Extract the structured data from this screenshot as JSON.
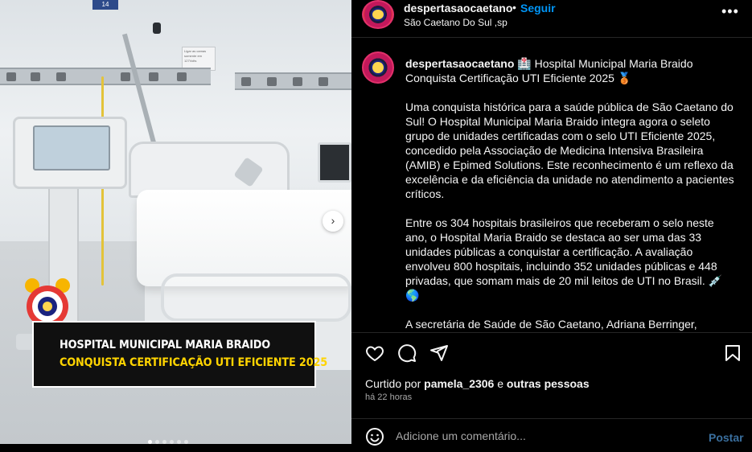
{
  "media": {
    "room_sign": "14",
    "wall_note": "Ligar as camas somente em 127Volts",
    "caption_line1": "HOSPITAL MUNICIPAL MARIA BRAIDO",
    "caption_line2": "CONQUISTA CERTIFICAÇÃO UTI EFICIENTE 2025",
    "next_icon": "›",
    "carousel_count": 6,
    "carousel_active": 0
  },
  "header": {
    "username": "despertasaocaetano",
    "separator": "•",
    "follow_label": "Seguir",
    "location": "São Caetano Do Sul ,sp",
    "more_icon": "•••"
  },
  "post": {
    "username": "despertasaocaetano",
    "title": "🏥 Hospital Municipal Maria Braido Conquista Certificação UTI Eficiente 2025 🥉",
    "paragraph1": "Uma conquista histórica para a saúde pública de São Caetano do Sul! O Hospital Municipal Maria Braido integra agora o seleto grupo de unidades certificadas com o selo UTI Eficiente 2025, concedido pela Associação de Medicina Intensiva Brasileira (AMIB) e Epimed Solutions. Este reconhecimento é um reflexo da excelência e da eficiência da unidade no atendimento a pacientes críticos.",
    "paragraph2": "Entre os 304 hospitais brasileiros que receberam o selo neste ano, o Hospital Maria Braido se destaca ao ser uma das 33 unidades públicas a conquistar a certificação. A avaliação envolveu 800 hospitais, incluindo 352 unidades públicas e 448 privadas, que somam mais de 20 mil leitos de UTI no Brasil. 💉🌎",
    "paragraph3": "A secretária de Saúde de São Caetano, Adriana Berringer, celebra"
  },
  "engagement": {
    "liked_prefix": "Curtido por",
    "liked_user": "pamela_2306",
    "liked_and": "e",
    "liked_others": "outras pessoas",
    "time_ago": "há 22 horas"
  },
  "comment": {
    "placeholder": "Adicione um comentário...",
    "post_label": "Postar"
  },
  "icons": {
    "like": "heart-icon",
    "comment": "comment-icon",
    "share": "share-icon",
    "save": "bookmark-icon",
    "emoji": "emoji-icon"
  },
  "colors": {
    "background": "#000000",
    "text": "#f5f5f5",
    "link_blue": "#0095f6",
    "muted": "#a8a8a8",
    "caption_yellow": "#ffd400"
  }
}
